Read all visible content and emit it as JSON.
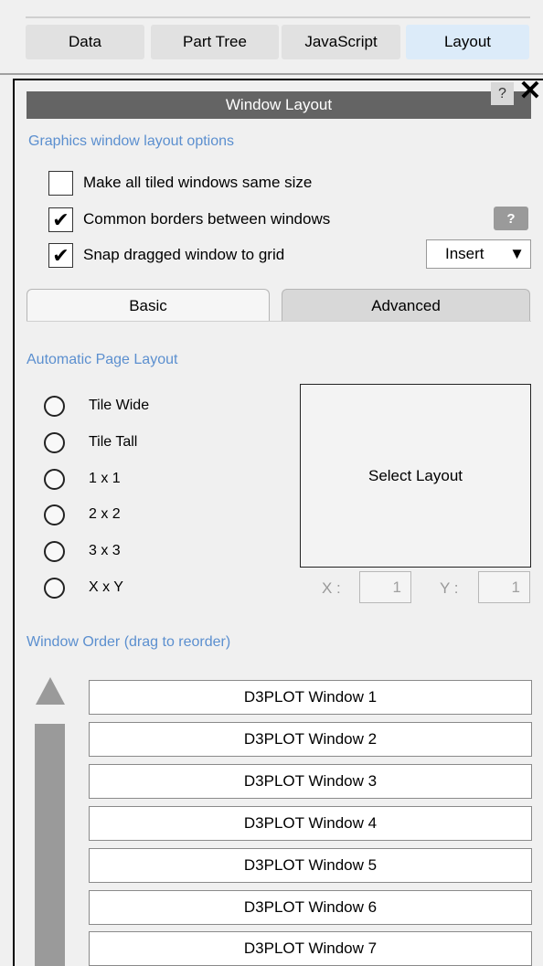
{
  "tabs": [
    {
      "label": "Data",
      "active": false
    },
    {
      "label": "Part Tree",
      "active": false
    },
    {
      "label": "JavaScript",
      "active": false
    },
    {
      "label": "Layout",
      "active": true
    }
  ],
  "panel": {
    "title": "Window Layout",
    "help_label": "?",
    "close_label": "✕"
  },
  "graphics_options": {
    "section_label": "Graphics window layout options",
    "options": [
      {
        "label": "Make all tiled windows same size",
        "checked": false,
        "mark": ""
      },
      {
        "label": "Common borders between windows",
        "checked": true,
        "mark": "✔"
      },
      {
        "label": "Snap dragged window to grid",
        "checked": true,
        "mark": "✔"
      }
    ],
    "help_label": "?",
    "insert_select": {
      "value": "Insert",
      "arrow": "▼"
    }
  },
  "inner_tabs": [
    {
      "label": "Basic",
      "active": true
    },
    {
      "label": "Advanced",
      "active": false
    }
  ],
  "auto_layout": {
    "section_label": "Automatic Page Layout",
    "options": [
      "Tile Wide",
      "Tile Tall",
      "1 x 1",
      "2 x 2",
      "3 x 3",
      "X x Y"
    ],
    "select_layout_label": "Select Layout",
    "x_label": "X :",
    "x_value": "1",
    "y_label": "Y :",
    "y_value": "1"
  },
  "window_order": {
    "section_label": "Window Order (drag to reorder)",
    "windows": [
      "D3PLOT Window 1",
      "D3PLOT Window 2",
      "D3PLOT Window 3",
      "D3PLOT Window 4",
      "D3PLOT Window 5",
      "D3PLOT Window 6",
      "D3PLOT Window 7"
    ]
  },
  "colors": {
    "title_bar": "#646464",
    "section_label": "#5b8fcf",
    "active_tab": "#dcebf9"
  }
}
